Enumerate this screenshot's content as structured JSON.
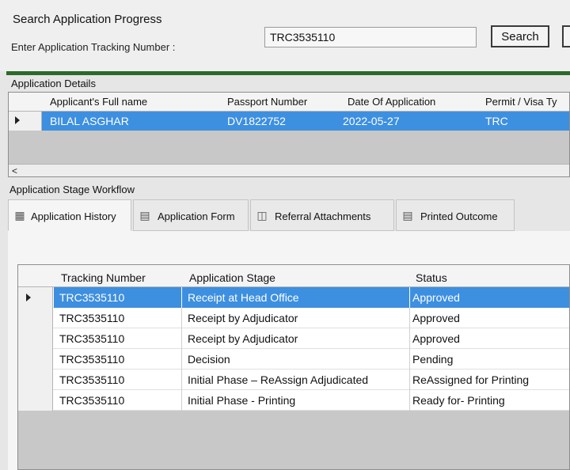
{
  "search": {
    "title": "Search Application Progress",
    "tracking_label": "Enter Application Tracking Number :",
    "tracking_value": "TRC3535110",
    "search_button": "Search"
  },
  "details": {
    "section_label": "Application Details",
    "columns": [
      "Applicant's Full name",
      "Passport Number",
      "Date Of Application",
      "Permit / Visa Ty"
    ],
    "row": {
      "name": "BILAL ASGHAR",
      "passport": "DV1822752",
      "date": "2022-05-27",
      "permit": "TRC"
    },
    "scroll_left_glyph": "<"
  },
  "workflow": {
    "section_label": "Application Stage Workflow",
    "tabs": [
      {
        "label": "Application History",
        "icon": "hierarchy-icon"
      },
      {
        "label": "Application Form",
        "icon": "form-icon"
      },
      {
        "label": "Referral Attachments",
        "icon": "attachments-icon"
      },
      {
        "label": "Printed Outcome",
        "icon": "document-icon"
      }
    ]
  },
  "stages": {
    "columns": [
      "Tracking Number",
      "Application Stage",
      "Status"
    ],
    "rows": [
      {
        "tracking": "TRC3535110",
        "stage": "Receipt at Head Office",
        "status": "Approved"
      },
      {
        "tracking": "TRC3535110",
        "stage": "Receipt by Adjudicator",
        "status": "Approved"
      },
      {
        "tracking": "TRC3535110",
        "stage": "Receipt by Adjudicator",
        "status": "Approved"
      },
      {
        "tracking": "TRC3535110",
        "stage": "Decision",
        "status": "Pending"
      },
      {
        "tracking": "TRC3535110",
        "stage": "Initial Phase – ReAssign Adjudicated",
        "status": "ReAssigned for Printing"
      },
      {
        "tracking": "TRC3535110",
        "stage": "Initial Phase - Printing",
        "status": "Ready for- Printing"
      }
    ]
  },
  "colors": {
    "selection": "#3d8fe0",
    "divider_green": "#2c6a2a"
  }
}
